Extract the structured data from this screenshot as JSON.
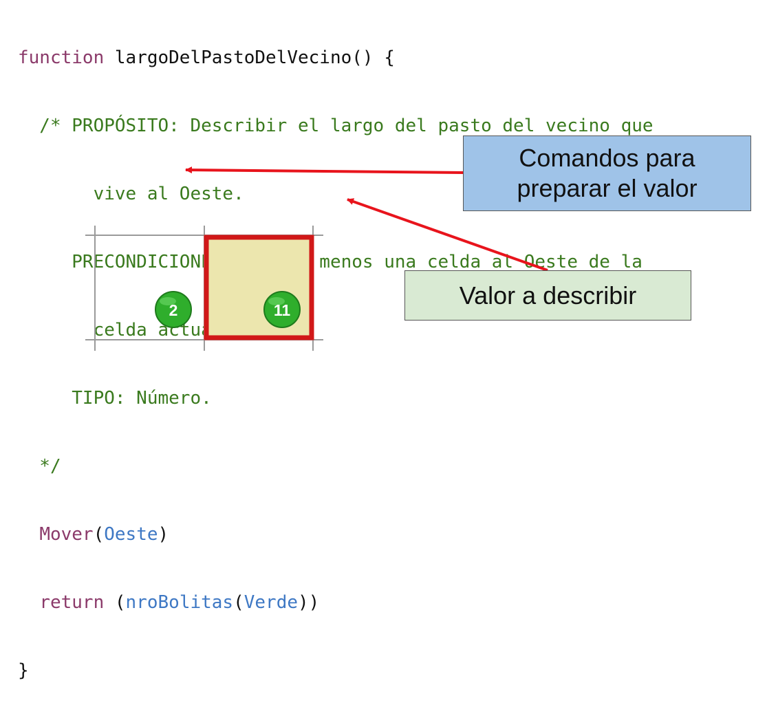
{
  "code": {
    "line1": {
      "kw": "function",
      "rest": " largoDelPastoDelVecino() {"
    },
    "line2": "  /* PROPÓSITO: Describir el largo del pasto del vecino que",
    "line3": "       vive al Oeste.",
    "line4": "     PRECONDICIONES: Hay al menos una celda al Oeste de la",
    "line5": "       celda actual.",
    "line6": "     TIPO: Número.",
    "line7": "  */",
    "line8": {
      "indent": "  ",
      "fn": "Mover",
      "open": "(",
      "arg": "Oeste",
      "close": ")"
    },
    "line9": {
      "indent": "  ",
      "kw": "return",
      "open": " (",
      "fn": "nroBolitas",
      "open2": "(",
      "arg": "Verde",
      "close": "))"
    },
    "line10": "}"
  },
  "callouts": {
    "commands_line1": "Comandos para",
    "commands_line2": "preparar el valor",
    "value": "Valor a describir"
  },
  "board": {
    "cells": [
      {
        "bolitas": "2",
        "selected": false
      },
      {
        "bolitas": "11",
        "selected": true
      }
    ]
  },
  "colors": {
    "keyword": "#8b3a6a",
    "comment": "#3a7a1e",
    "identifier": "#3e78c4",
    "arrow": "#e8141c",
    "callout_blue": "#9fc3e8",
    "callout_green": "#d9ead3",
    "selected_cell_border": "#d11818",
    "selected_cell_fill": "#ece6ae",
    "bolita_green": "#2fae2c"
  }
}
